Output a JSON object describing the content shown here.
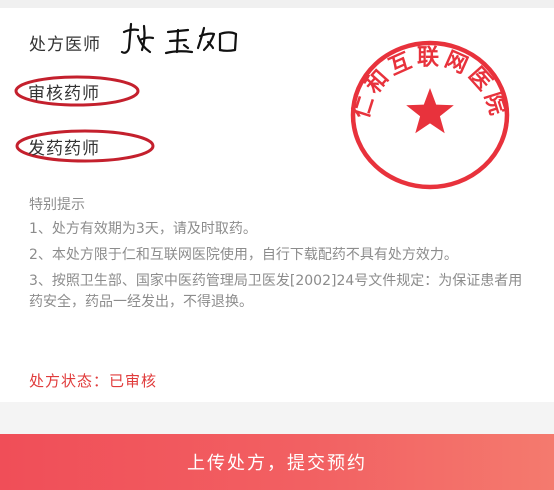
{
  "prescription": {
    "prescriber_label": "处方医师",
    "reviewer_label": "审核药师",
    "dispenser_label": "发药药师",
    "stamp_text": "仁和互联网医院",
    "signature": "张玉如"
  },
  "notice": {
    "title": "特别提示",
    "items": [
      "1、处方有效期为3天，请及时取药。",
      "2、本处方限于仁和互联网医院使用，自行下载配药不具有处方效力。",
      "3、按照卫生部、国家中医药管理局卫医发[2002]24号文件规定：为保证患者用药安全，药品一经发出，不得退换。"
    ]
  },
  "status": {
    "text": "处方状态：已审核"
  },
  "action": {
    "submit_label": "上传处方，提交预约"
  },
  "colors": {
    "seal_red": "#e8323c",
    "accent_red": "#e03b3b",
    "button_red": "#f05a5e",
    "circle_red": "#c4202d"
  }
}
